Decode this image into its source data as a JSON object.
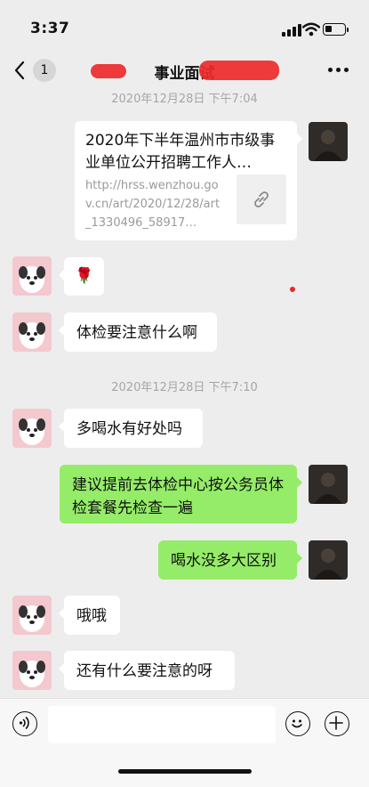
{
  "status_bar": {
    "time": "3:37"
  },
  "nav": {
    "unread_count": "1",
    "title": "事业面试"
  },
  "messages": {
    "ts1": "2020年12月28日 下午7:04",
    "link_title": "2020年下半年温州市市级事业单位公开招聘工作人…",
    "link_url": "http://hrss.wenzhou.gov.cn/art/2020/12/28/art_1330496_58917…",
    "rose": "🌹",
    "m1": "体检要注意什么啊",
    "ts2": "2020年12月28日 下午7:10",
    "m2": "多喝水有好处吗",
    "m3": "建议提前去体检中心按公务员体检套餐先检查一遍",
    "m4": "喝水没多大区别",
    "m5": "哦哦",
    "m6": "还有什么要注意的呀"
  },
  "input": {
    "placeholder": ""
  },
  "icons": {
    "back": "chevron-left-icon",
    "more": "more-dots-icon",
    "link": "link-icon",
    "voice": "voice-icon",
    "emoji": "emoji-icon",
    "plus": "plus-icon"
  },
  "colors": {
    "bubble_self": "#95ec69",
    "bubble_other": "#ffffff",
    "background": "#ededed"
  }
}
